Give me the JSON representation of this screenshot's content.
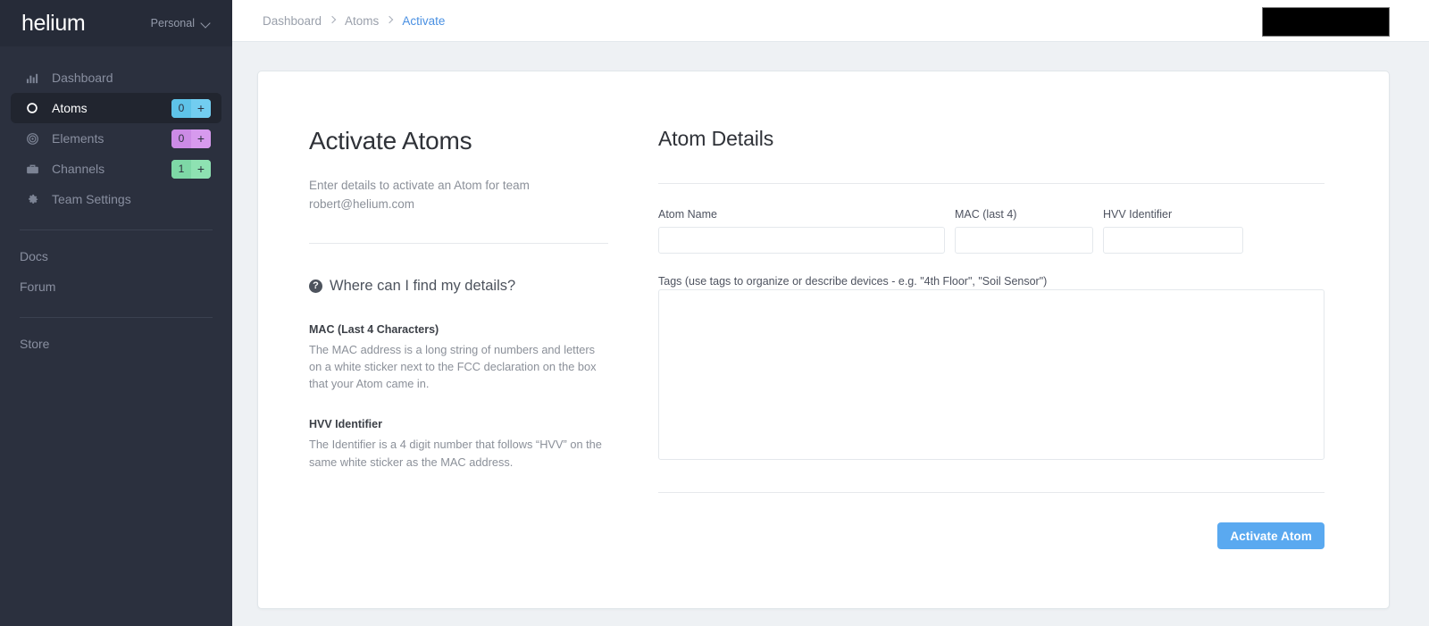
{
  "sidebar": {
    "brand": "helium",
    "team_switcher": {
      "label": "Personal",
      "icon": "chevron-down-icon"
    },
    "nav_items": [
      {
        "label": "Dashboard",
        "icon": "bar-chart-icon",
        "active": false,
        "badge": null
      },
      {
        "label": "Atoms",
        "icon": "circle-icon",
        "active": true,
        "badge": {
          "count": "0",
          "plus": "+",
          "color_dark": "#5ec3e8",
          "color_light": "#72cdf0"
        }
      },
      {
        "label": "Elements",
        "icon": "target-icon",
        "active": false,
        "badge": {
          "count": "0",
          "plus": "+",
          "color_dark": "#cc8be6",
          "color_light": "#d79aee"
        }
      },
      {
        "label": "Channels",
        "icon": "briefcase-icon",
        "active": false,
        "badge": {
          "count": "1",
          "plus": "+",
          "color_dark": "#7ed8a6",
          "color_light": "#8ee2b2"
        }
      },
      {
        "label": "Team Settings",
        "icon": "gear-icon",
        "active": false,
        "badge": null
      }
    ],
    "links_group_1": [
      {
        "label": "Docs"
      },
      {
        "label": "Forum"
      }
    ],
    "links_group_2": [
      {
        "label": "Store"
      }
    ]
  },
  "topbar": {
    "breadcrumbs": [
      {
        "label": "Dashboard",
        "current": false
      },
      {
        "label": "Atoms",
        "current": false
      },
      {
        "label": "Activate",
        "current": true
      }
    ],
    "redaction_box": "redacted"
  },
  "left_panel": {
    "title": "Activate Atoms",
    "lead": "Enter details to activate an Atom for team robert@helium.com",
    "help_heading": "Where can I find my details?",
    "help_icon": "question-mark-circle-icon",
    "faqs": [
      {
        "question": "MAC (Last 4 Characters)",
        "answer": "The MAC address is a long string of numbers and letters on a white sticker next to the FCC declaration on the box that your Atom came in."
      },
      {
        "question": "HVV Identifier",
        "answer": "The Identifier is a 4 digit number that follows “HVV” on the same white sticker as the MAC address."
      }
    ]
  },
  "form": {
    "title": "Atom Details",
    "fields": [
      {
        "label": "Atom Name",
        "value": "",
        "placeholder": ""
      },
      {
        "label": "MAC (last 4)",
        "value": "",
        "placeholder": ""
      },
      {
        "label": "HVV Identifier",
        "value": "",
        "placeholder": ""
      }
    ],
    "tags": {
      "label": "Tags (use tags to organize or describe devices - e.g. \"4th Floor\", \"Soil Sensor\")",
      "value": "",
      "placeholder": ""
    },
    "submit_label": "Activate Atom"
  },
  "colors": {
    "sidebar_bg": "#2b303e",
    "sidebar_brand_bg": "#262b38",
    "sidebar_active_bg": "#21252f",
    "page_bg": "#eef1f4",
    "accent_link": "#4a90e2",
    "primary_button": "#5aa9f0"
  }
}
